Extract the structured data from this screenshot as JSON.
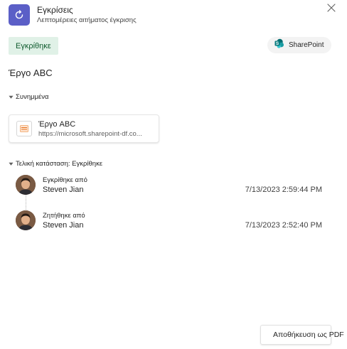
{
  "header": {
    "app_title": "Εγκρίσεις",
    "app_subtitle": "Λεπτομέρειες αιτήματος έγκρισης",
    "app_icon": "approvals-refresh-icon",
    "close_icon": "close-icon"
  },
  "status": {
    "label": "Εγκρίθηκε"
  },
  "sharepoint_button": {
    "label": "SharePoint"
  },
  "request": {
    "title": "Έργο ABC"
  },
  "attachments": {
    "section_label": "Συνημμένα",
    "items": [
      {
        "name": "Έργο ABC",
        "url": "https://microsoft.sharepoint-df.co..."
      }
    ]
  },
  "final_status": {
    "section_label": "Τελική κατάσταση: Εγκρίθηκε",
    "timeline": [
      {
        "role": "Εγκρίθηκε από",
        "name": "Steven Jian",
        "date": "7/13/2023 2:59:44 PM"
      },
      {
        "role": "Ζητήθηκε από",
        "name": "Steven Jian",
        "date": "7/13/2023 2:52:40 PM"
      }
    ]
  },
  "footer": {
    "save_pdf_label": "Αποθήκευση ως PDF"
  },
  "colors": {
    "accent": "#5b5fc7",
    "approved_bg": "#e0f1e7",
    "approved_text": "#0e5a2d",
    "sharepoint": "#038387"
  }
}
